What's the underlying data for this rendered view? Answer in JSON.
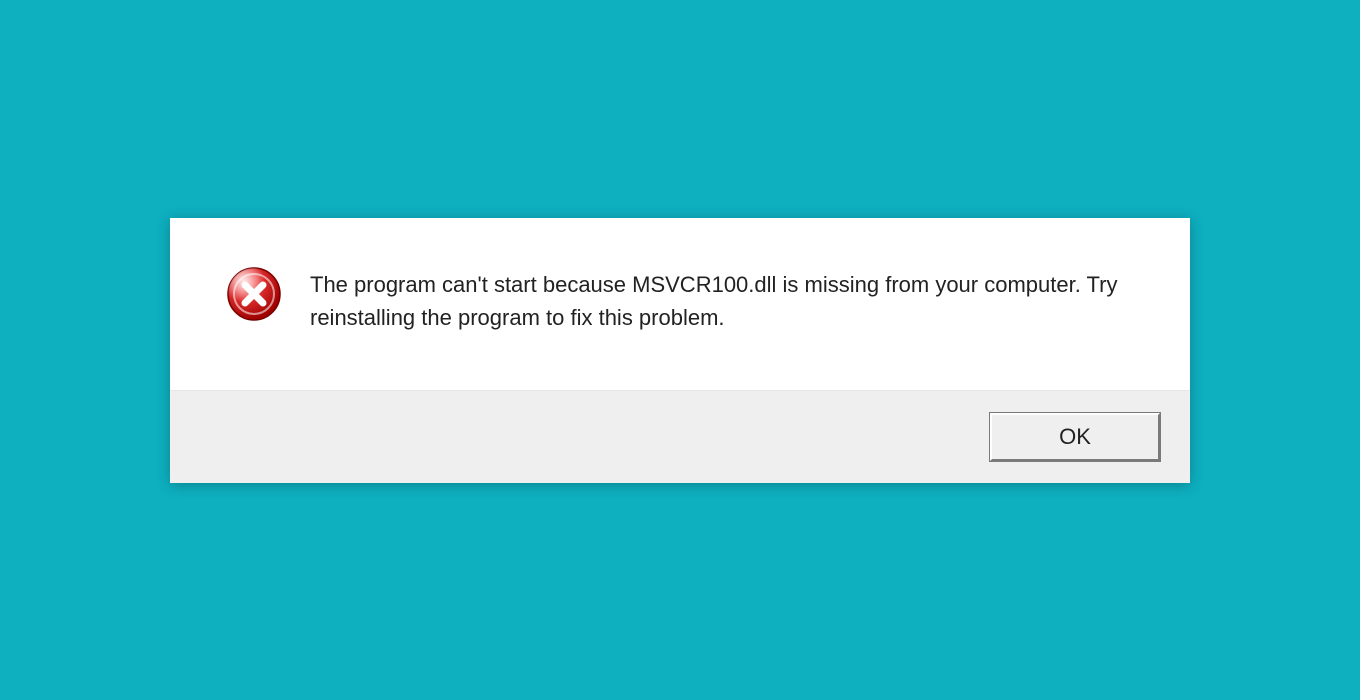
{
  "dialog": {
    "message": "The program can't start because MSVCR100.dll is missing from your computer. Try reinstalling the program to fix this problem.",
    "ok_label": "OK",
    "icon": "error-icon"
  }
}
